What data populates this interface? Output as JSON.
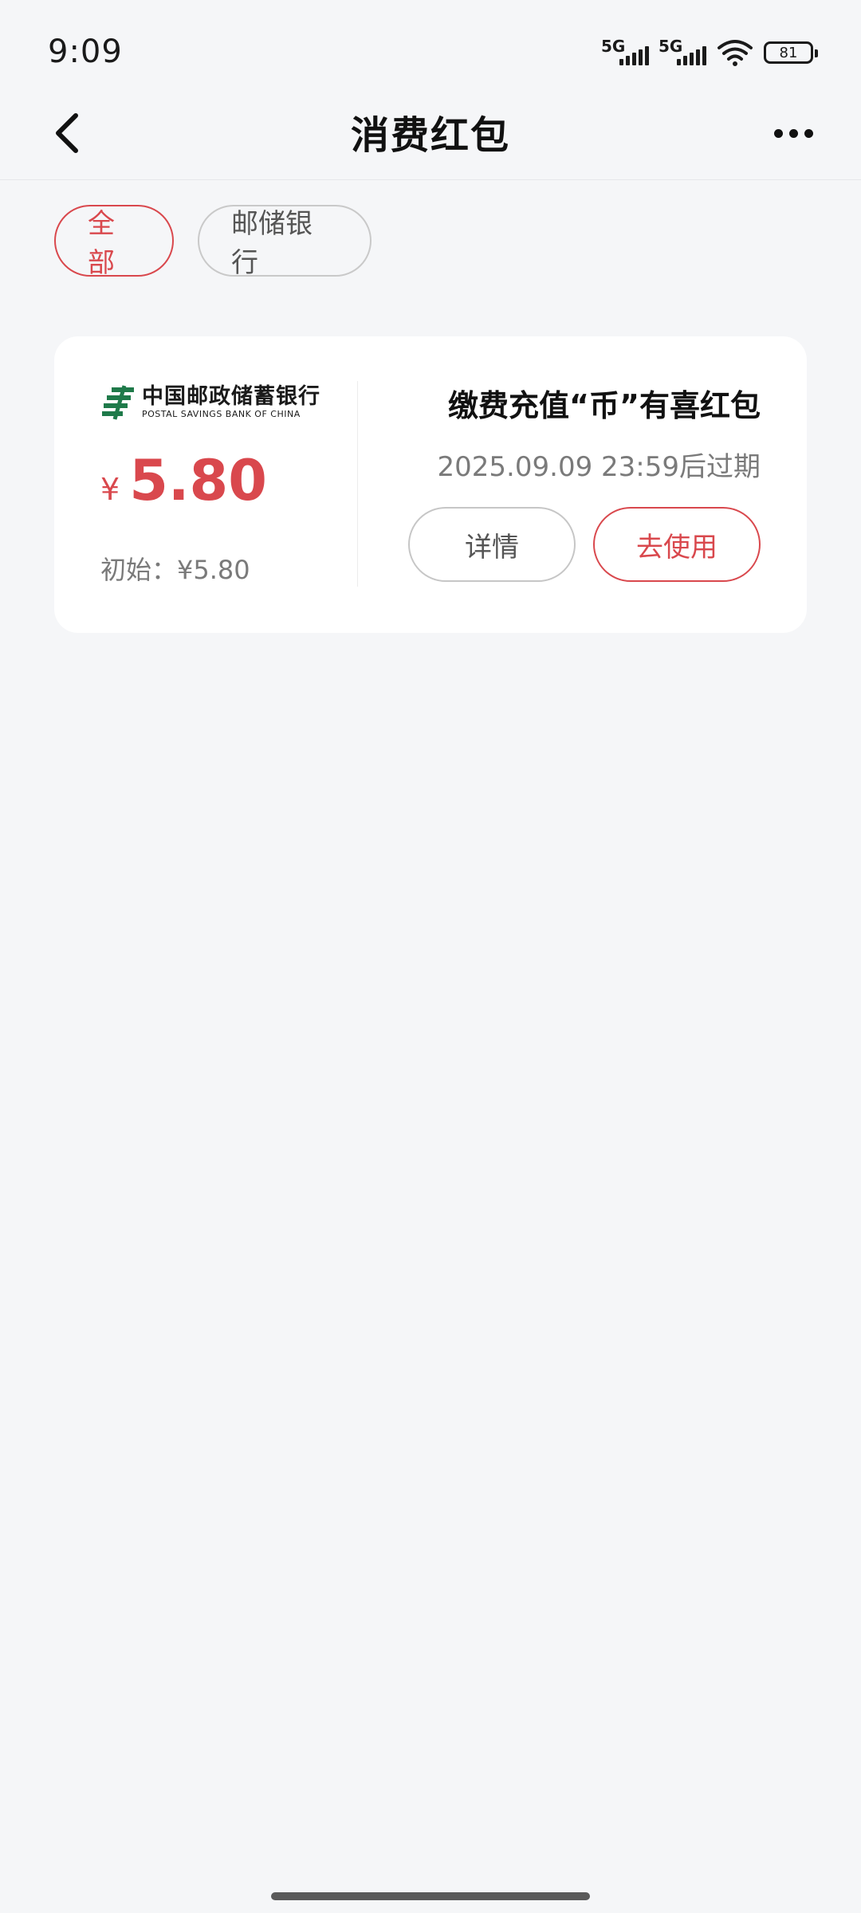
{
  "status_bar": {
    "time": "9:09",
    "network_1": "5G",
    "network_2": "5G",
    "battery": "81"
  },
  "nav": {
    "title": "消费红包",
    "back_icon": "chevron-left-icon",
    "more_icon": "more-horizontal-icon"
  },
  "filters": [
    {
      "label": "全部",
      "active": true
    },
    {
      "label": "邮储银行",
      "active": false
    }
  ],
  "coupons": [
    {
      "bank_name_cn": "中国邮政储蓄银行",
      "bank_name_en": "POSTAL SAVINGS BANK OF CHINA",
      "currency_symbol": "¥",
      "amount": "5.80",
      "initial_label": "初始：¥5.80",
      "title": "缴费充值“币”有喜红包",
      "expiry": "2025.09.09 23:59后过期",
      "detail_button": "详情",
      "use_button": "去使用"
    }
  ],
  "colors": {
    "accent": "#d9484d",
    "background": "#f5f6f8",
    "card": "#ffffff",
    "logo_green": "#1f7a4a"
  }
}
